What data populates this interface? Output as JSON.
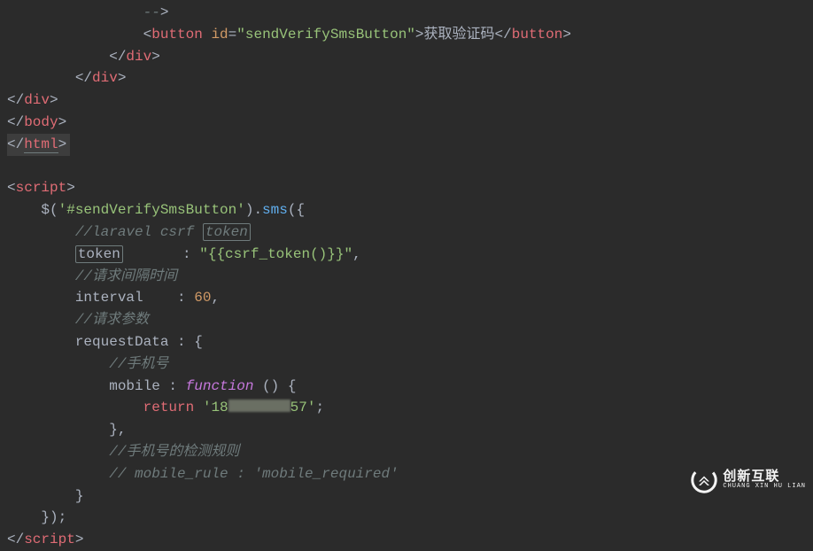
{
  "code": {
    "line1_indent": "                ",
    "line1_comment": "--",
    "line1_angle1": ">",
    "line2_indent": "                ",
    "line2_open": "<",
    "line2_tag": "button",
    "line2_sp": " ",
    "line2_attr": "id",
    "line2_eq": "=",
    "line2_str": "\"sendVerifySmsButton\"",
    "line2_close": ">",
    "line2_text": "获取验证码",
    "line2_open2": "</",
    "line2_tag2": "button",
    "line2_close2": ">",
    "line3_indent": "            ",
    "line3_open": "</",
    "line3_tag": "div",
    "line3_close": ">",
    "line4_indent": "        ",
    "line4_open": "</",
    "line4_tag": "div",
    "line4_close": ">",
    "line5_indent": "",
    "line5_open": "</",
    "line5_tag": "div",
    "line5_close": ">",
    "line6_indent": "",
    "line6_open": "</",
    "line6_tag": "body",
    "line6_close": ">",
    "line7_indent": "",
    "line7_open": "</",
    "line7_tag": "html",
    "line7_close": ">",
    "line9_indent": "",
    "line9_open": "<",
    "line9_tag": "script",
    "line9_close": ">",
    "line10_indent": "    ",
    "line10_a": "$(",
    "line10_str": "'#sendVerifySmsButton'",
    "line10_b": ").",
    "line10_method": "sms",
    "line10_c": "({",
    "line11_indent": "        ",
    "line11_comment_a": "//laravel csrf ",
    "line11_comment_b": "token",
    "line12_indent": "        ",
    "line12_prop": "token",
    "line12_space": "       : ",
    "line12_val": "\"{{csrf_token()}}\"",
    "line12_end": ",",
    "line13_indent": "        ",
    "line13_comment": "//请求间隔时间",
    "line14_indent": "        ",
    "line14_prop": "interval",
    "line14_space": "    : ",
    "line14_val": "60",
    "line14_end": ",",
    "line15_indent": "        ",
    "line15_comment": "//请求参数",
    "line16_indent": "        ",
    "line16_prop": "requestData",
    "line16_space": " : ",
    "line16_brace": "{",
    "line17_indent": "            ",
    "line17_comment": "//手机号",
    "line18_indent": "            ",
    "line18_prop": "mobile",
    "line18_space": " : ",
    "line18_kw": "function",
    "line18_rest": " () {",
    "line19_indent": "                ",
    "line19_ret": "return",
    "line19_sp": " ",
    "line19_str_a": "'18",
    "line19_str_b": "57'",
    "line19_end": ";",
    "line20_indent": "            ",
    "line20_brace": "},",
    "line21_indent": "            ",
    "line21_comment": "//手机号的检测规则",
    "line22_indent": "            ",
    "line22_comment": "// mobile_rule : 'mobile_required'",
    "line23_indent": "        ",
    "line23_brace": "}",
    "line24_indent": "    ",
    "line24_brace": "});",
    "line25_indent": "",
    "line25_open": "</",
    "line25_tag": "script",
    "line25_close": ">"
  },
  "watermark": {
    "title": "创新互联",
    "subtitle": "CHUANG XIN HU LIAN"
  }
}
